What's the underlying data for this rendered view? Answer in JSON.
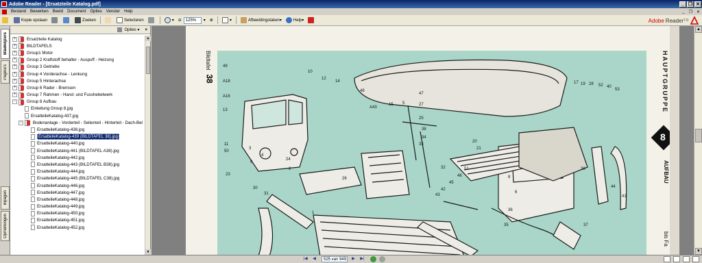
{
  "window": {
    "title": "Adobe Reader - [Ersatzteile Katalog.pdf]",
    "controls": [
      "_",
      "❐",
      "✕"
    ]
  },
  "menubar": {
    "items": [
      "Bestand",
      "Bewerken",
      "Beeld",
      "Document",
      "Opties",
      "Venster",
      "Help"
    ],
    "doc_controls": [
      "_",
      "❐",
      "✕"
    ]
  },
  "toolbar": {
    "save_copy": "Kopie opslaan",
    "search": "Zoeken",
    "select": "Selecteren",
    "zoom_value": "125%",
    "image_tasks": "Afbeeldingstaken",
    "help": "Help",
    "brand_prefix": "Adobe",
    "brand_product": "Reader",
    "brand_version": "7.0"
  },
  "side_tabs": {
    "bookmarks": "Bladwijzers",
    "pages": "Pagina's",
    "layers": "Bijlagen",
    "signatures": "Opmerkingen"
  },
  "panel": {
    "options_label": "Opties",
    "close": "×"
  },
  "bookmarks": [
    {
      "label": "Ersatzteile Katalog",
      "indent": 0,
      "exp": "+",
      "icon": "bm"
    },
    {
      "label": "BILDTAFELS",
      "indent": 0,
      "exp": "+",
      "icon": "bm"
    },
    {
      "label": "Group1 Motor",
      "indent": 0,
      "exp": "+",
      "icon": "bm"
    },
    {
      "label": "Group 2 Kraftstoff behalter - Auspuff - Heizung",
      "indent": 0,
      "exp": "+",
      "icon": "bm"
    },
    {
      "label": "Group 3 Getriebe",
      "indent": 0,
      "exp": "+",
      "icon": "bm"
    },
    {
      "label": "Group 4 Vorderachse - Lenkung",
      "indent": 0,
      "exp": "+",
      "icon": "bm"
    },
    {
      "label": "Group 5 Hinterachse",
      "indent": 0,
      "exp": "+",
      "icon": "bm"
    },
    {
      "label": "Group 6 Rader - Bremsen",
      "indent": 0,
      "exp": "+",
      "icon": "bm"
    },
    {
      "label": "Group 7 Rahmen - Hand- und Fusshebelwerk",
      "indent": 0,
      "exp": "+",
      "icon": "bm"
    },
    {
      "label": "Group 8 Aufbau",
      "indent": 0,
      "exp": "−",
      "icon": "bm"
    },
    {
      "label": "Einleitung Group 8.jpg",
      "indent": 1,
      "exp": "",
      "icon": "pg"
    },
    {
      "label": "ErsatteileKatalog-437.jpg",
      "indent": 1,
      "exp": "",
      "icon": "pg"
    },
    {
      "label": "Bodenanlage - Vorderteil - Seitenteil - Hinterteil - Dach-Bel",
      "indent": 1,
      "exp": "−",
      "icon": "bm"
    },
    {
      "label": "ErsatteileKatalog-438.jpg",
      "indent": 2,
      "exp": "",
      "icon": "pg"
    },
    {
      "label": "ErsatteileKatalog-439 (BILDTAFEL 38).jpg",
      "indent": 2,
      "exp": "",
      "icon": "pg",
      "selected": true
    },
    {
      "label": "ErsatteileKatalog-440.jpg",
      "indent": 2,
      "exp": "",
      "icon": "pg"
    },
    {
      "label": "ErsatteileKatalog-441 (BILDTAFEL A38).jpg",
      "indent": 2,
      "exp": "",
      "icon": "pg"
    },
    {
      "label": "ErsatteileKatalog-442.jpg",
      "indent": 2,
      "exp": "",
      "icon": "pg"
    },
    {
      "label": "ErsatteileKatalog-443 (BILDTAFEL B38).jpg",
      "indent": 2,
      "exp": "",
      "icon": "pg"
    },
    {
      "label": "ErsatteileKatalog-444.jpg",
      "indent": 2,
      "exp": "",
      "icon": "pg"
    },
    {
      "label": "ErsatteileKatalog-445 (BILDTAFEL C38).jpg",
      "indent": 2,
      "exp": "",
      "icon": "pg"
    },
    {
      "label": "ErsatteileKatalog-446.jpg",
      "indent": 2,
      "exp": "",
      "icon": "pg"
    },
    {
      "label": "ErsatteileKatalog-447.jpg",
      "indent": 2,
      "exp": "",
      "icon": "pg"
    },
    {
      "label": "ErsatteileKatalog-448.jpg",
      "indent": 2,
      "exp": "",
      "icon": "pg"
    },
    {
      "label": "ErsatteileKatalog-449.jpg",
      "indent": 2,
      "exp": "",
      "icon": "pg"
    },
    {
      "label": "ErsatteileKatalog-450.jpg",
      "indent": 2,
      "exp": "",
      "icon": "pg"
    },
    {
      "label": "ErsatteileKatalog-451.jpg",
      "indent": 2,
      "exp": "",
      "icon": "pg"
    },
    {
      "label": "ErsatteileKatalog-452.jpg",
      "indent": 2,
      "exp": "",
      "icon": "pg"
    }
  ],
  "document": {
    "plate_label": "Bildtafel",
    "plate_number": "38",
    "group_heading": "HAUPTGRUPPE",
    "group_number": "8",
    "group_name": "AUFBAU",
    "footer_fragment": "bis Fa",
    "part_numbers": [
      "49",
      "A18",
      "A16",
      "13",
      "10",
      "12",
      "14",
      "48",
      "47",
      "27",
      "A43",
      "5",
      "15",
      "25",
      "11",
      "50",
      "3",
      "4",
      "2",
      "24",
      "9",
      "26",
      "23",
      "30",
      "31",
      "1",
      "36",
      "35",
      "6",
      "8",
      "32",
      "38",
      "34",
      "33",
      "17",
      "19",
      "28",
      "52",
      "40",
      "53",
      "39",
      "44",
      "41",
      "37",
      "20",
      "21",
      "51",
      "46",
      "45",
      "42",
      "43"
    ]
  },
  "status": {
    "page_display": "525 van 949",
    "nav": [
      "|◀",
      "◀",
      "▶",
      "▶|"
    ]
  }
}
